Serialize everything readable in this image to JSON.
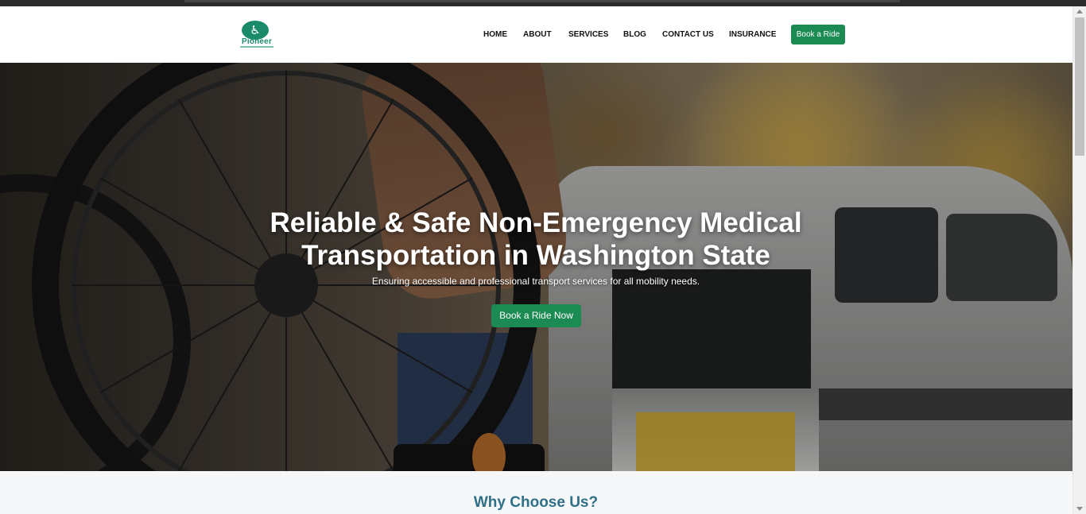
{
  "brand": {
    "name": "Pioneer",
    "accent_color": "#1b8a53",
    "logo_color": "#1b8a6b"
  },
  "nav": {
    "items": [
      {
        "label": "HOME"
      },
      {
        "label": "ABOUT"
      },
      {
        "label": "SERVICES"
      },
      {
        "label": "BLOG"
      },
      {
        "label": "CONTACT US"
      },
      {
        "label": "INSURANCE"
      }
    ],
    "cta_label": "Book a Ride"
  },
  "hero": {
    "title_line1": "Reliable & Safe Non-Emergency Medical",
    "title_line2": "Transportation in Washington State",
    "subtitle": "Ensuring accessible and professional transport services for all mobility needs.",
    "cta_label": "Book a Ride Now",
    "background_image": "wheelchair-and-accessible-van-photo"
  },
  "why": {
    "title": "Why Choose Us?",
    "title_color": "#2f6f88"
  }
}
